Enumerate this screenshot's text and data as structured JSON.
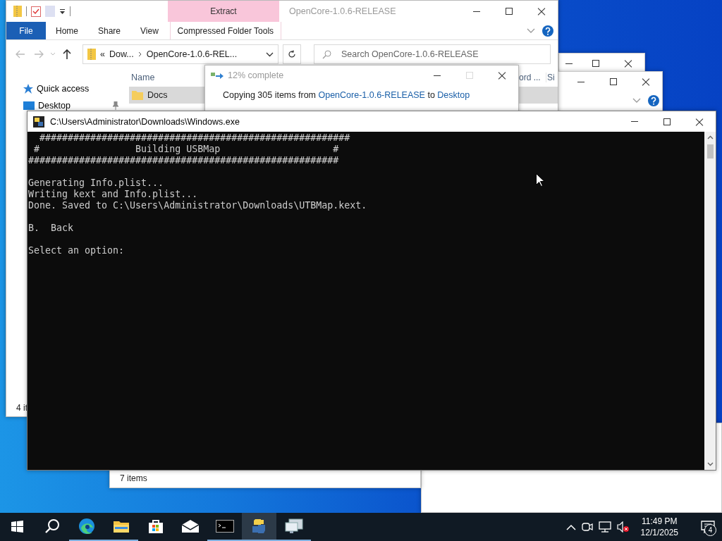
{
  "explorer": {
    "title": "OpenCore-1.0.6-RELEASE",
    "context_label": "Extract",
    "ribbon_tabs": [
      {
        "label": "File",
        "kind": "file"
      },
      {
        "label": "Home",
        "kind": "tab"
      },
      {
        "label": "Share",
        "kind": "tab"
      },
      {
        "label": "View",
        "kind": "tab"
      },
      {
        "label": "Compressed Folder Tools",
        "kind": "contextual"
      }
    ],
    "address": {
      "overflow": "«",
      "segments": [
        "Dow...",
        "OpenCore-1.0.6-REL..."
      ]
    },
    "search": {
      "placeholder": "Search OpenCore-1.0.6-RELEASE"
    },
    "nav_items": [
      {
        "label": "Quick access",
        "kind": "star",
        "pinned": false
      },
      {
        "label": "Desktop",
        "kind": "desktop",
        "pinned": true
      }
    ],
    "columns": [
      "Name",
      "ord ...",
      "Si"
    ],
    "rows": [
      {
        "name": "Docs",
        "selected": true
      }
    ],
    "status_bar": "4 it"
  },
  "copy_dialog": {
    "title": "12% complete",
    "maximize_disabled": true,
    "message": [
      {
        "text": "Copying 305 items from ",
        "kind": "plain"
      },
      {
        "text": "OpenCore-1.0.6-RELEASE",
        "kind": "link"
      },
      {
        "text": " to ",
        "kind": "plain"
      },
      {
        "text": "Desktop",
        "kind": "link"
      }
    ]
  },
  "back_window": {
    "status_bar": "7 items"
  },
  "console": {
    "title": "C:\\Users\\Administrator\\Downloads\\Windows.exe",
    "blocks": [
      [
        "  #######################################################",
        " #                 Building USBMap                    #",
        "#######################################################"
      ],
      [
        "Generating Info.plist...",
        "Writing kext and Info.plist...",
        "Done. Saved to C:\\Users\\Administrator\\Downloads\\UTBMap.kext."
      ],
      [
        "B.  Back"
      ],
      [
        "Select an option:"
      ]
    ]
  },
  "taskbar": {
    "items": [
      {
        "kind": "start"
      },
      {
        "kind": "search"
      },
      {
        "kind": "edge",
        "running": true,
        "selected": false
      },
      {
        "kind": "explorer",
        "running": true,
        "selected": false
      },
      {
        "kind": "store",
        "running": false,
        "selected": false
      },
      {
        "kind": "mail",
        "running": false,
        "selected": false
      },
      {
        "kind": "terminal",
        "running": true,
        "selected": false
      },
      {
        "kind": "python",
        "running": true,
        "selected": true
      },
      {
        "kind": "remote",
        "running": true,
        "selected": false
      }
    ],
    "tray": [
      {
        "kind": "caret"
      },
      {
        "kind": "meet"
      },
      {
        "kind": "network"
      },
      {
        "kind": "volume-muted"
      }
    ],
    "clock": {
      "time": "11:49 PM",
      "date": "12/1/2025"
    },
    "notifications": "4"
  }
}
